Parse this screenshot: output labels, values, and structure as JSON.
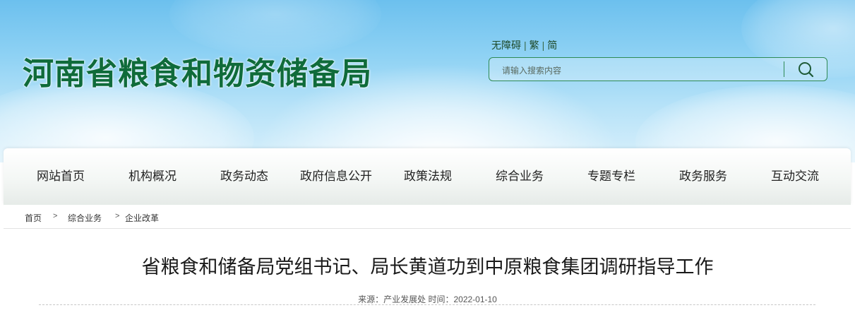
{
  "header": {
    "site_title": "河南省粮食和物资储备局",
    "access_links": [
      "无障碍",
      "繁",
      "简"
    ],
    "search": {
      "placeholder": "请输入搜索内容"
    }
  },
  "nav": {
    "items": [
      "网站首页",
      "机构概况",
      "政务动态",
      "政府信息公开",
      "政策法规",
      "综合业务",
      "专题专栏",
      "政务服务",
      "互动交流"
    ]
  },
  "breadcrumb": {
    "items": [
      "首页",
      "综合业务",
      "企业改革"
    ],
    "separator": ">"
  },
  "article": {
    "title": "省粮食和储备局党组书记、局长黄道功到中原粮食集团调研指导工作",
    "meta": "来源：产业发展处 时间：2022-01-10"
  },
  "colors": {
    "brand_green": "#0f6b3a",
    "search_border": "#2e8a55",
    "sky": "#8fd2f4"
  },
  "icons": {
    "search": "search-icon"
  }
}
